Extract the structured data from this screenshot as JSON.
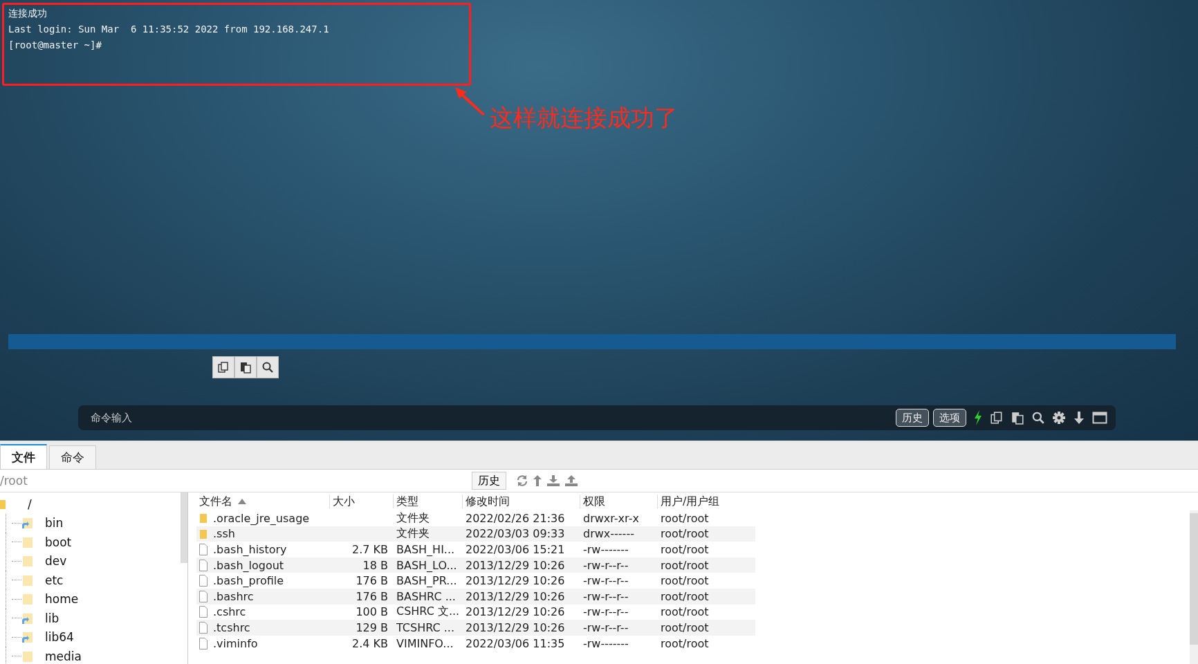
{
  "terminal": {
    "lines": [
      "连接成功",
      "Last login: Sun Mar  6 11:35:52 2022 from 192.168.247.1",
      "[root@master ~]#"
    ]
  },
  "annotation": {
    "text": "这样就连接成功了"
  },
  "command_bar": {
    "placeholder": "命令输入",
    "buttons": [
      "历史",
      "选项"
    ]
  },
  "tabs": [
    {
      "label": "文件",
      "selected": true
    },
    {
      "label": "命令",
      "selected": false
    }
  ],
  "path_bar": {
    "value": "/root",
    "history_button": "历史"
  },
  "tree": {
    "label": "/",
    "children": [
      {
        "label": "bin",
        "link": true
      },
      {
        "label": "boot",
        "link": false
      },
      {
        "label": "dev",
        "link": false
      },
      {
        "label": "etc",
        "link": false
      },
      {
        "label": "home",
        "link": false
      },
      {
        "label": "lib",
        "link": true
      },
      {
        "label": "lib64",
        "link": true
      },
      {
        "label": "media",
        "link": false
      }
    ]
  },
  "table": {
    "columns": [
      {
        "label": "文件名",
        "sorted": true
      },
      {
        "label": "大小",
        "sorted": false
      },
      {
        "label": "类型",
        "sorted": false
      },
      {
        "label": "修改时间",
        "sorted": false
      },
      {
        "label": "权限",
        "sorted": false
      },
      {
        "label": "用户/用户组",
        "sorted": false
      }
    ],
    "rows": [
      {
        "kind": "folder",
        "name": ".oracle_jre_usage",
        "size": "",
        "type": "文件夹",
        "modified": "2022/02/26 21:36",
        "perm": "drwxr-xr-x",
        "owner": "root/root"
      },
      {
        "kind": "folder",
        "name": ".ssh",
        "size": "",
        "type": "文件夹",
        "modified": "2022/03/03 09:33",
        "perm": "drwx------",
        "owner": "root/root"
      },
      {
        "kind": "file",
        "name": ".bash_history",
        "size": "2.7 KB",
        "type": "BASH_HI...",
        "modified": "2022/03/06 15:21",
        "perm": "-rw-------",
        "owner": "root/root"
      },
      {
        "kind": "file",
        "name": ".bash_logout",
        "size": "18 B",
        "type": "BASH_LO...",
        "modified": "2013/12/29 10:26",
        "perm": "-rw-r--r--",
        "owner": "root/root"
      },
      {
        "kind": "file",
        "name": ".bash_profile",
        "size": "176 B",
        "type": "BASH_PR...",
        "modified": "2013/12/29 10:26",
        "perm": "-rw-r--r--",
        "owner": "root/root"
      },
      {
        "kind": "file",
        "name": ".bashrc",
        "size": "176 B",
        "type": "BASHRC ...",
        "modified": "2013/12/29 10:26",
        "perm": "-rw-r--r--",
        "owner": "root/root"
      },
      {
        "kind": "file",
        "name": ".cshrc",
        "size": "100 B",
        "type": "CSHRC 文...",
        "modified": "2013/12/29 10:26",
        "perm": "-rw-r--r--",
        "owner": "root/root"
      },
      {
        "kind": "file",
        "name": ".tcshrc",
        "size": "129 B",
        "type": "TCSHRC ...",
        "modified": "2013/12/29 10:26",
        "perm": "-rw-r--r--",
        "owner": "root/root"
      },
      {
        "kind": "file",
        "name": ".viminfo",
        "size": "2.4 KB",
        "type": "VIMINFO...",
        "modified": "2022/03/06 11:35",
        "perm": "-rw-------",
        "owner": "root/root"
      }
    ]
  }
}
